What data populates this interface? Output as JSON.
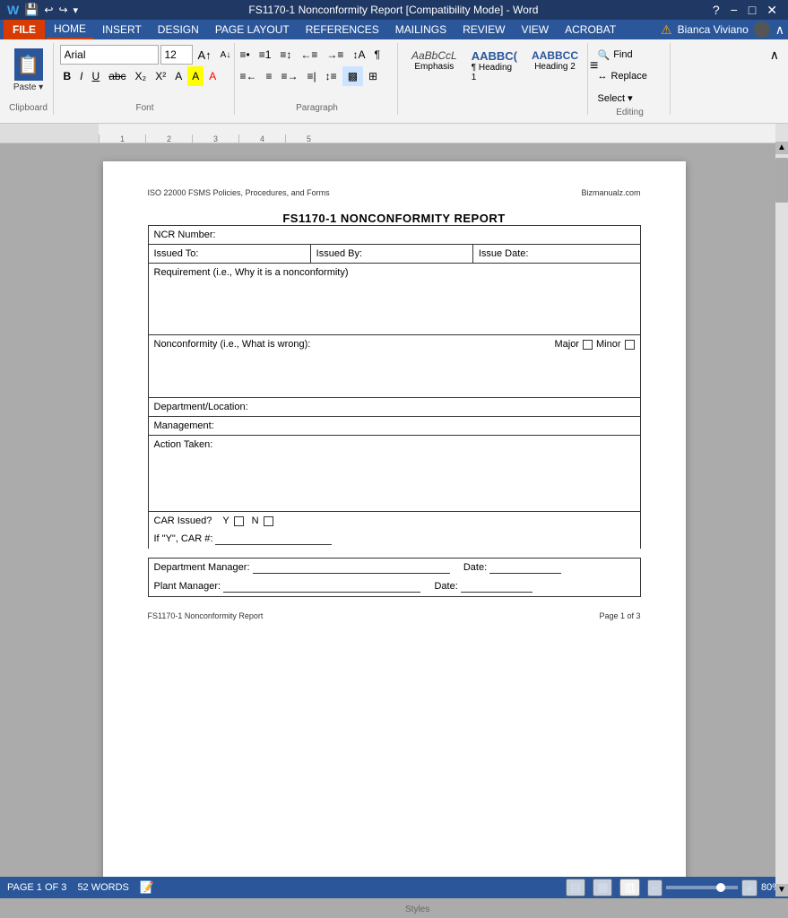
{
  "titlebar": {
    "title": "FS1170-1 Nonconformity Report [Compatibility Mode] - Word",
    "minimize": "−",
    "restore": "□",
    "close": "✕",
    "help": "?"
  },
  "menubar": {
    "file": "FILE",
    "tabs": [
      "HOME",
      "INSERT",
      "DESIGN",
      "PAGE LAYOUT",
      "REFERENCES",
      "MAILINGS",
      "REVIEW",
      "VIEW",
      "ACROBAT"
    ],
    "user": "Bianca Viviano",
    "warning_text": "⚠"
  },
  "ribbon": {
    "paste_label": "Paste",
    "clipboard_label": "Clipboard",
    "font_name": "Arial",
    "font_size": "12",
    "font_label": "Font",
    "bold": "B",
    "italic": "I",
    "underline": "U",
    "paragraph_label": "Paragraph",
    "styles": [
      {
        "name": "Emphasis",
        "label": "AaBbCcL",
        "style": "emphasis"
      },
      {
        "name": "Heading 1",
        "label": "AABBC(",
        "style": "heading1"
      },
      {
        "name": "Heading 2",
        "label": "AABBCC",
        "style": "heading2"
      }
    ],
    "styles_label": "Styles",
    "find": "Find",
    "replace": "Replace",
    "select": "Select ▾",
    "editing_label": "Editing"
  },
  "document": {
    "header_left": "ISO 22000 FSMS Policies, Procedures, and Forms",
    "header_right": "Bizmanualz.com",
    "title": "FS1170-1 NONCONFORMITY REPORT",
    "fields": {
      "ncr_number_label": "NCR Number:",
      "issued_to_label": "Issued To:",
      "issued_by_label": "Issued By:",
      "issue_date_label": "Issue Date:",
      "requirement_label": "Requirement (i.e., Why it is a nonconformity)",
      "nonconformity_label": "Nonconformity (i.e., What is wrong):",
      "major_label": "Major",
      "minor_label": "Minor",
      "dept_location_label": "Department/Location:",
      "management_label": "Management:",
      "action_taken_label": "Action Taken:",
      "car_issued_label": "CAR Issued?",
      "car_y_label": "Y",
      "car_n_label": "N",
      "if_y_car_label": "If \"Y\", CAR #:",
      "dept_manager_label": "Department Manager:",
      "dept_manager_date_label": "Date:",
      "plant_manager_label": "Plant Manager:",
      "plant_manager_date_label": "Date:"
    },
    "footer_left": "FS1170-1 Nonconformity Report",
    "footer_right": "Page 1 of 3"
  },
  "statusbar": {
    "page_info": "PAGE 1 OF 3",
    "words": "52 WORDS",
    "view_buttons": [
      "▤",
      "▦",
      "▥"
    ],
    "zoom_percent": "80%",
    "zoom_minus": "−",
    "zoom_plus": "+"
  }
}
